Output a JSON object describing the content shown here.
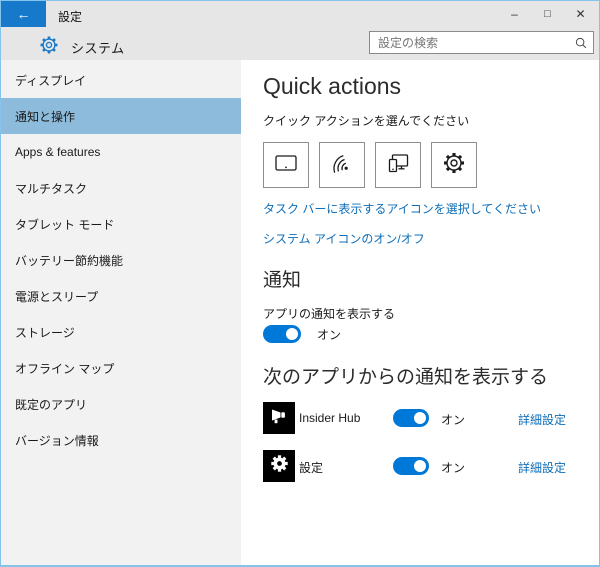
{
  "window": {
    "title": "設定",
    "back_icon": "←",
    "controls": [
      {
        "name": "minimize",
        "glyph": "–"
      },
      {
        "name": "maximize",
        "glyph": "□"
      },
      {
        "name": "close",
        "glyph": "✕"
      }
    ]
  },
  "header": {
    "app_section_title": "システム",
    "search_placeholder": "設定の検索",
    "search_icon": "magnifier"
  },
  "sidebar": {
    "items": [
      {
        "label": "ディスプレイ"
      },
      {
        "label": "通知と操作",
        "selected": true
      },
      {
        "label": "Apps & features"
      },
      {
        "label": "マルチタスク"
      },
      {
        "label": "タブレット モード"
      },
      {
        "label": "バッテリー節約機能"
      },
      {
        "label": "電源とスリープ"
      },
      {
        "label": "ストレージ"
      },
      {
        "label": "オフライン マップ"
      },
      {
        "label": "既定のアプリ"
      },
      {
        "label": "バージョン情報"
      }
    ]
  },
  "main": {
    "quick_actions": {
      "title": "Quick actions",
      "subtitle": "クイック アクションを選んでください",
      "tiles": [
        {
          "icon": "tablet-icon"
        },
        {
          "icon": "wireless-icon"
        },
        {
          "icon": "connect-icon"
        },
        {
          "icon": "gear-icon"
        }
      ],
      "taskbar_link": "タスク バーに表示するアイコンを選択してください",
      "system_icons_link": "システム アイコンのオン/オフ"
    },
    "notifications": {
      "section_title": "通知",
      "show_app_notifications_label": "アプリの通知を表示する",
      "show_app_notifications_state": "オン",
      "per_app_section_title": "次のアプリからの通知を表示する",
      "apps": [
        {
          "name": "Insider Hub",
          "icon": "megaphone-icon",
          "state": "オン",
          "link": "詳細設定"
        },
        {
          "name": "設定",
          "icon": "gear-icon",
          "state": "オン",
          "link": "詳細設定"
        }
      ]
    }
  },
  "colors": {
    "accent_toggle": "#0078d7",
    "back_button": "#1779ca",
    "selected_nav_bg": "#8dbbdb",
    "link": "#0e6eb8",
    "window_border": "#84c3ea",
    "titlebar_bg": "#e6e6e6",
    "sidebar_bg": "#f2f2f2",
    "tile_icon_bg": "#000000"
  }
}
